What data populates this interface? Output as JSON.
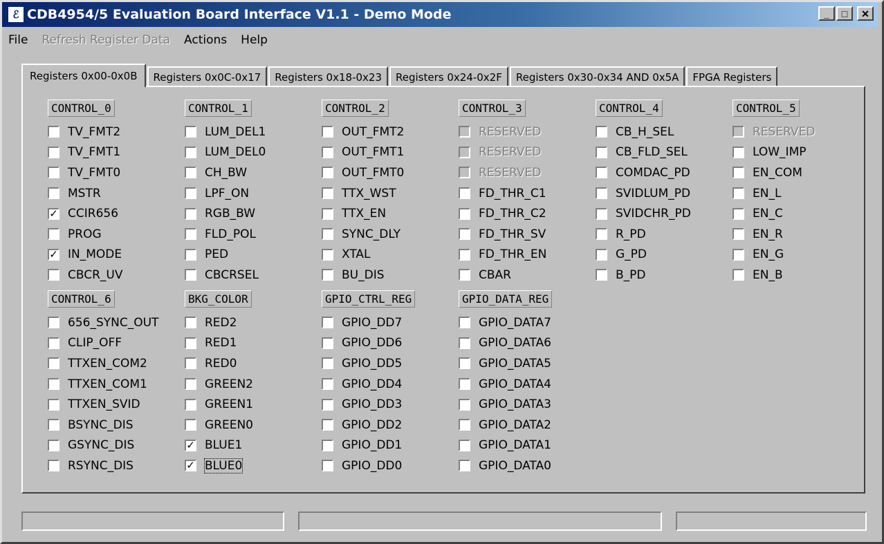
{
  "window": {
    "title": "CDB4954/5 Evaluation Board Interface V1.1 - Demo Mode"
  },
  "menu": [
    {
      "label": "File",
      "disabled": false
    },
    {
      "label": "Refresh Register Data",
      "disabled": true
    },
    {
      "label": "Actions",
      "disabled": false
    },
    {
      "label": "Help",
      "disabled": false
    }
  ],
  "tabs": [
    {
      "label": "Registers 0x00-0x0B",
      "active": true
    },
    {
      "label": "Registers 0x0C-0x17",
      "active": false
    },
    {
      "label": "Registers 0x18-0x23",
      "active": false
    },
    {
      "label": "Registers 0x24-0x2F",
      "active": false
    },
    {
      "label": "Registers 0x30-0x34 AND 0x5A",
      "active": false
    },
    {
      "label": "FPGA Registers",
      "active": false
    }
  ],
  "groups": [
    {
      "label": "CONTROL_0",
      "items": [
        {
          "label": "TV_FMT2",
          "checked": false
        },
        {
          "label": "TV_FMT1",
          "checked": false
        },
        {
          "label": "TV_FMT0",
          "checked": false
        },
        {
          "label": "MSTR",
          "checked": false
        },
        {
          "label": "CCIR656",
          "checked": true
        },
        {
          "label": "PROG",
          "checked": false
        },
        {
          "label": "IN_MODE",
          "checked": true
        },
        {
          "label": "CBCR_UV",
          "checked": false
        }
      ]
    },
    {
      "label": "CONTROL_1",
      "items": [
        {
          "label": "LUM_DEL1",
          "checked": false
        },
        {
          "label": "LUM_DEL0",
          "checked": false
        },
        {
          "label": "CH_BW",
          "checked": false
        },
        {
          "label": "LPF_ON",
          "checked": false
        },
        {
          "label": "RGB_BW",
          "checked": false
        },
        {
          "label": "FLD_POL",
          "checked": false
        },
        {
          "label": "PED",
          "checked": false
        },
        {
          "label": "CBCRSEL",
          "checked": false
        }
      ]
    },
    {
      "label": "CONTROL_2",
      "items": [
        {
          "label": "OUT_FMT2",
          "checked": false
        },
        {
          "label": "OUT_FMT1",
          "checked": false
        },
        {
          "label": "OUT_FMT0",
          "checked": false
        },
        {
          "label": "TTX_WST",
          "checked": false
        },
        {
          "label": "TTX_EN",
          "checked": false
        },
        {
          "label": "SYNC_DLY",
          "checked": false
        },
        {
          "label": "XTAL",
          "checked": false
        },
        {
          "label": "BU_DIS",
          "checked": false
        }
      ]
    },
    {
      "label": "CONTROL_3",
      "items": [
        {
          "label": "RESERVED",
          "checked": false,
          "disabled": true
        },
        {
          "label": "RESERVED",
          "checked": false,
          "disabled": true
        },
        {
          "label": "RESERVED",
          "checked": false,
          "disabled": true
        },
        {
          "label": "FD_THR_C1",
          "checked": false
        },
        {
          "label": "FD_THR_C2",
          "checked": false
        },
        {
          "label": "FD_THR_SV",
          "checked": false
        },
        {
          "label": "FD_THR_EN",
          "checked": false
        },
        {
          "label": "CBAR",
          "checked": false
        }
      ]
    },
    {
      "label": "CONTROL_4",
      "items": [
        {
          "label": "CB_H_SEL",
          "checked": false
        },
        {
          "label": "CB_FLD_SEL",
          "checked": false
        },
        {
          "label": "COMDAC_PD",
          "checked": false
        },
        {
          "label": "SVIDLUM_PD",
          "checked": false
        },
        {
          "label": "SVIDCHR_PD",
          "checked": false
        },
        {
          "label": "R_PD",
          "checked": false
        },
        {
          "label": "G_PD",
          "checked": false
        },
        {
          "label": "B_PD",
          "checked": false
        }
      ]
    },
    {
      "label": "CONTROL_5",
      "items": [
        {
          "label": "RESERVED",
          "checked": false,
          "disabled": true
        },
        {
          "label": "LOW_IMP",
          "checked": false
        },
        {
          "label": "EN_COM",
          "checked": false
        },
        {
          "label": "EN_L",
          "checked": false
        },
        {
          "label": "EN_C",
          "checked": false
        },
        {
          "label": "EN_R",
          "checked": false
        },
        {
          "label": "EN_G",
          "checked": false
        },
        {
          "label": "EN_B",
          "checked": false
        }
      ]
    },
    {
      "label": "CONTROL_6",
      "items": [
        {
          "label": "656_SYNC_OUT",
          "checked": false
        },
        {
          "label": "CLIP_OFF",
          "checked": false
        },
        {
          "label": "TTXEN_COM2",
          "checked": false
        },
        {
          "label": "TTXEN_COM1",
          "checked": false
        },
        {
          "label": "TTXEN_SVID",
          "checked": false
        },
        {
          "label": "BSYNC_DIS",
          "checked": false
        },
        {
          "label": "GSYNC_DIS",
          "checked": false
        },
        {
          "label": "RSYNC_DIS",
          "checked": false
        }
      ]
    },
    {
      "label": "BKG_COLOR",
      "items": [
        {
          "label": "RED2",
          "checked": false
        },
        {
          "label": "RED1",
          "checked": false
        },
        {
          "label": "RED0",
          "checked": false
        },
        {
          "label": "GREEN2",
          "checked": false
        },
        {
          "label": "GREEN1",
          "checked": false
        },
        {
          "label": "GREEN0",
          "checked": false
        },
        {
          "label": "BLUE1",
          "checked": true
        },
        {
          "label": "BLUE0",
          "checked": true,
          "focused": true
        }
      ]
    },
    {
      "label": "GPIO_CTRL_REG",
      "items": [
        {
          "label": "GPIO_DD7",
          "checked": false
        },
        {
          "label": "GPIO_DD6",
          "checked": false
        },
        {
          "label": "GPIO_DD5",
          "checked": false
        },
        {
          "label": "GPIO_DD4",
          "checked": false
        },
        {
          "label": "GPIO_DD3",
          "checked": false
        },
        {
          "label": "GPIO_DD2",
          "checked": false
        },
        {
          "label": "GPIO_DD1",
          "checked": false
        },
        {
          "label": "GPIO_DD0",
          "checked": false
        }
      ]
    },
    {
      "label": "GPIO_DATA_REG",
      "items": [
        {
          "label": "GPIO_DATA7",
          "checked": false
        },
        {
          "label": "GPIO_DATA6",
          "checked": false
        },
        {
          "label": "GPIO_DATA5",
          "checked": false
        },
        {
          "label": "GPIO_DATA4",
          "checked": false
        },
        {
          "label": "GPIO_DATA3",
          "checked": false
        },
        {
          "label": "GPIO_DATA2",
          "checked": false
        },
        {
          "label": "GPIO_DATA1",
          "checked": false
        },
        {
          "label": "GPIO_DATA0",
          "checked": false
        }
      ]
    }
  ],
  "statusbar": [
    "",
    "",
    ""
  ],
  "icons": {
    "app": "app-logo-icon",
    "minimize": "minimize-icon",
    "maximize": "maximize-icon",
    "close": "close-icon"
  }
}
